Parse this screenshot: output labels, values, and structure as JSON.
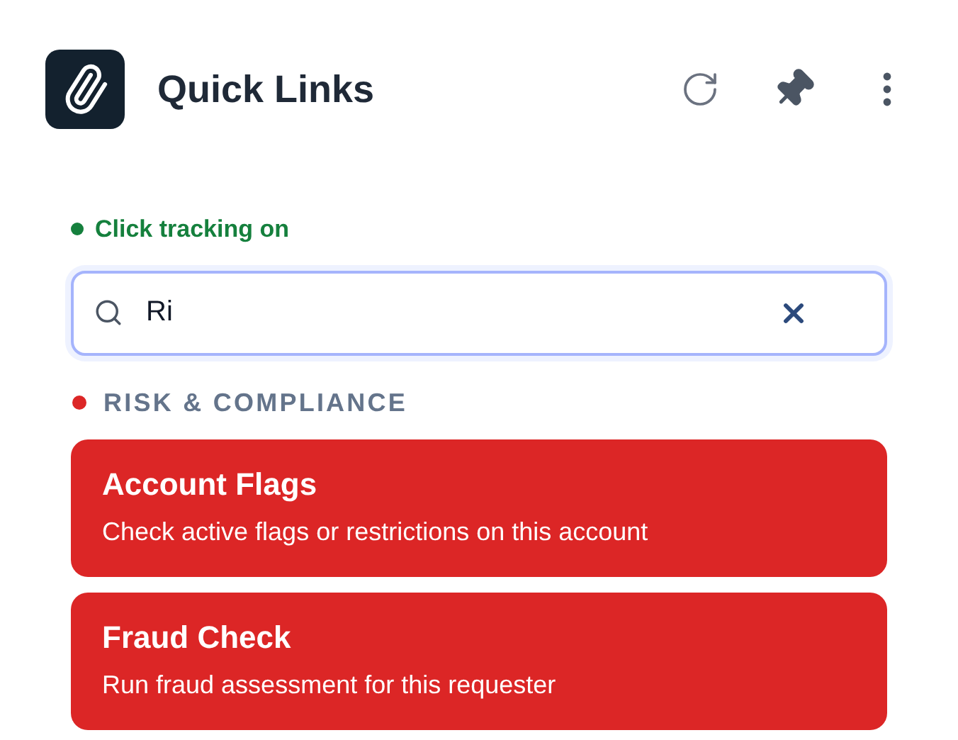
{
  "header": {
    "title": "Quick Links"
  },
  "status": {
    "text": "Click tracking on",
    "on": true
  },
  "search": {
    "value": "Ri"
  },
  "sections": [
    {
      "title": "RISK & COMPLIANCE",
      "color": "#dc2626",
      "links": [
        {
          "title": "Account Flags",
          "description": "Check active flags or restrictions on this account"
        },
        {
          "title": "Fraud Check",
          "description": "Run fraud assessment for this requester"
        }
      ]
    }
  ]
}
